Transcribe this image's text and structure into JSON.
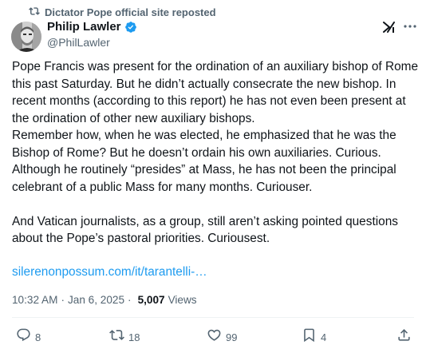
{
  "repost_banner": {
    "text": "Dictator Pope official site reposted"
  },
  "author": {
    "name": "Philip Lawler",
    "handle": "@PhilLawler",
    "verified": true
  },
  "tweet": {
    "body": "Pope Francis was present for the ordination of an auxiliary bishop of Rome this past Saturday. But he didn’t actually consecrate the new bishop. In recent months (according to this report) he has not even been present at the ordination of other new auxiliary bishops.\nRemember how, when he was elected, he emphasized that he was the Bishop of Rome? But he doesn’t ordain his own auxiliaries. Curious. Although he routinely “presides” at Mass, he has not been the principal celebrant of a public Mass for many months. Curiouser.\n\nAnd Vatican journalists, as a group, still aren’t asking pointed questions about the Pope’s pastoral priorities. Curiousest.",
    "link": "silerenonpossum.com/it/tarantelli-…"
  },
  "meta": {
    "time": "10:32 AM",
    "separator": "·",
    "date": "Jan 6, 2025",
    "views_count": "5,007",
    "views_label": "Views"
  },
  "actions": {
    "replies": "8",
    "reposts": "18",
    "likes": "99",
    "bookmarks": "4"
  },
  "colors": {
    "text": "#0f1419",
    "secondary": "#536471",
    "link": "#1d9bf0",
    "verified": "#1d9bf0",
    "divider": "#eff3f4"
  },
  "icons": [
    "repost-icon",
    "verified-badge-icon",
    "grok-icon",
    "more-icon",
    "reply-icon",
    "repost-icon",
    "like-icon",
    "bookmark-icon",
    "share-icon"
  ]
}
